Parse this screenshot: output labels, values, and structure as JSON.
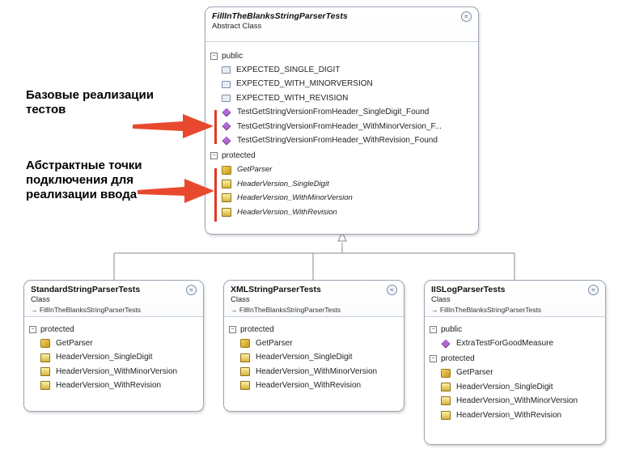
{
  "abstract_class": {
    "title": "FillInTheBlanksStringParserTests",
    "kind": "Abstract Class",
    "public_label": "public",
    "public_members": [
      "EXPECTED_SINGLE_DIGIT",
      "EXPECTED_WITH_MINORVERSION",
      "EXPECTED_WITH_REVISION",
      "TestGetStringVersionFromHeader_SingleDigit_Found",
      "TestGetStringVersionFromHeader_WithMinorVersion_F...",
      "TestGetStringVersionFromHeader_WithRevision_Found"
    ],
    "protected_label": "protected",
    "protected_members": [
      "GetParser",
      "HeaderVersion_SingleDigit",
      "HeaderVersion_WithMinorVersion",
      "HeaderVersion_WithRevision"
    ]
  },
  "annotations": {
    "base_impl": "Базовые реализации тестов",
    "abstract_points": "Абстрактные точки подключения для реализации ввода"
  },
  "derived": [
    {
      "title": "StandardStringParserTests",
      "kind": "Class",
      "base": "FillInTheBlanksStringParserTests",
      "protected_label": "protected",
      "protected_members": [
        "GetParser",
        "HeaderVersion_SingleDigit",
        "HeaderVersion_WithMinorVersion",
        "HeaderVersion_WithRevision"
      ]
    },
    {
      "title": "XMLStringParserTests",
      "kind": "Class",
      "base": "FillInTheBlanksStringParserTests",
      "protected_label": "protected",
      "protected_members": [
        "GetParser",
        "HeaderVersion_SingleDigit",
        "HeaderVersion_WithMinorVersion",
        "HeaderVersion_WithRevision"
      ]
    },
    {
      "title": "IISLogParserTests",
      "kind": "Class",
      "base": "FillInTheBlanksStringParserTests",
      "public_label": "public",
      "public_members": [
        "ExtraTestForGoodMeasure"
      ],
      "protected_label": "protected",
      "protected_members": [
        "GetParser",
        "HeaderVersion_SingleDigit",
        "HeaderVersion_WithMinorVersion",
        "HeaderVersion_WithRevision"
      ]
    }
  ],
  "base_arrow_glyph": "→",
  "collapse_glyph": "≈",
  "section_glyph": "−",
  "colors": {
    "accent_red": "#e03a24",
    "method_purple": "#b06ad0",
    "border": "#9aa5b4"
  }
}
